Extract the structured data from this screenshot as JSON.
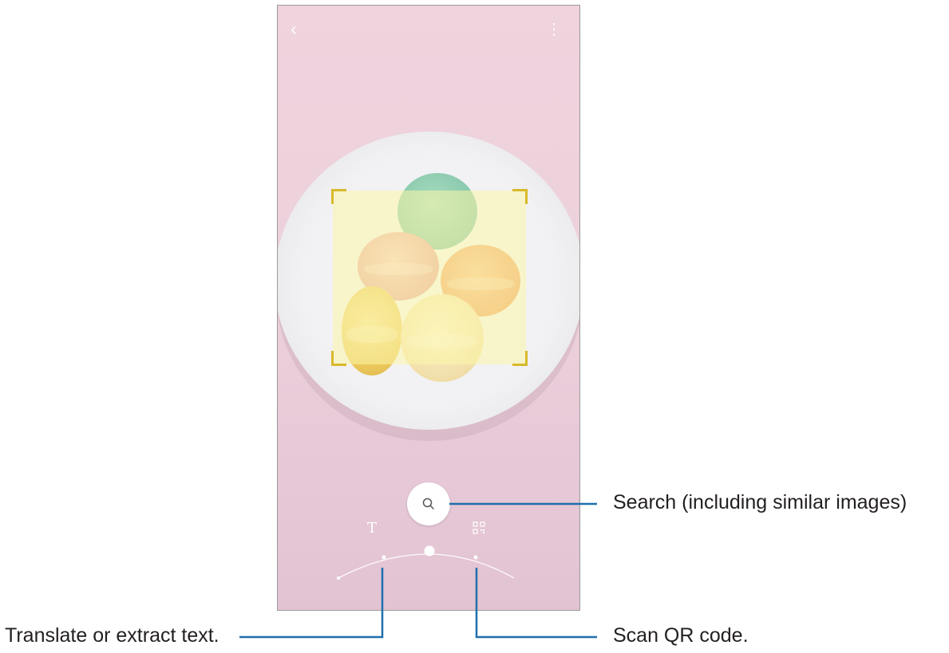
{
  "screen": {
    "top_bar": {
      "back_icon": "chevron-left-icon",
      "more_icon": "more-vertical-icon"
    },
    "modes": {
      "search_icon": "search-icon",
      "text_mode_glyph": "T",
      "text_mode_icon": "text-icon",
      "qr_mode_icon": "qr-code-icon"
    },
    "colors": {
      "selection_fill": "#fcf6a8",
      "selection_corner": "#d8b92c",
      "background": "#ecd1dc",
      "callout_line": "#1f6fae"
    }
  },
  "callouts": {
    "search": "Search (including similar images)",
    "translate": "Translate or extract text.",
    "qr": "Scan QR code."
  }
}
